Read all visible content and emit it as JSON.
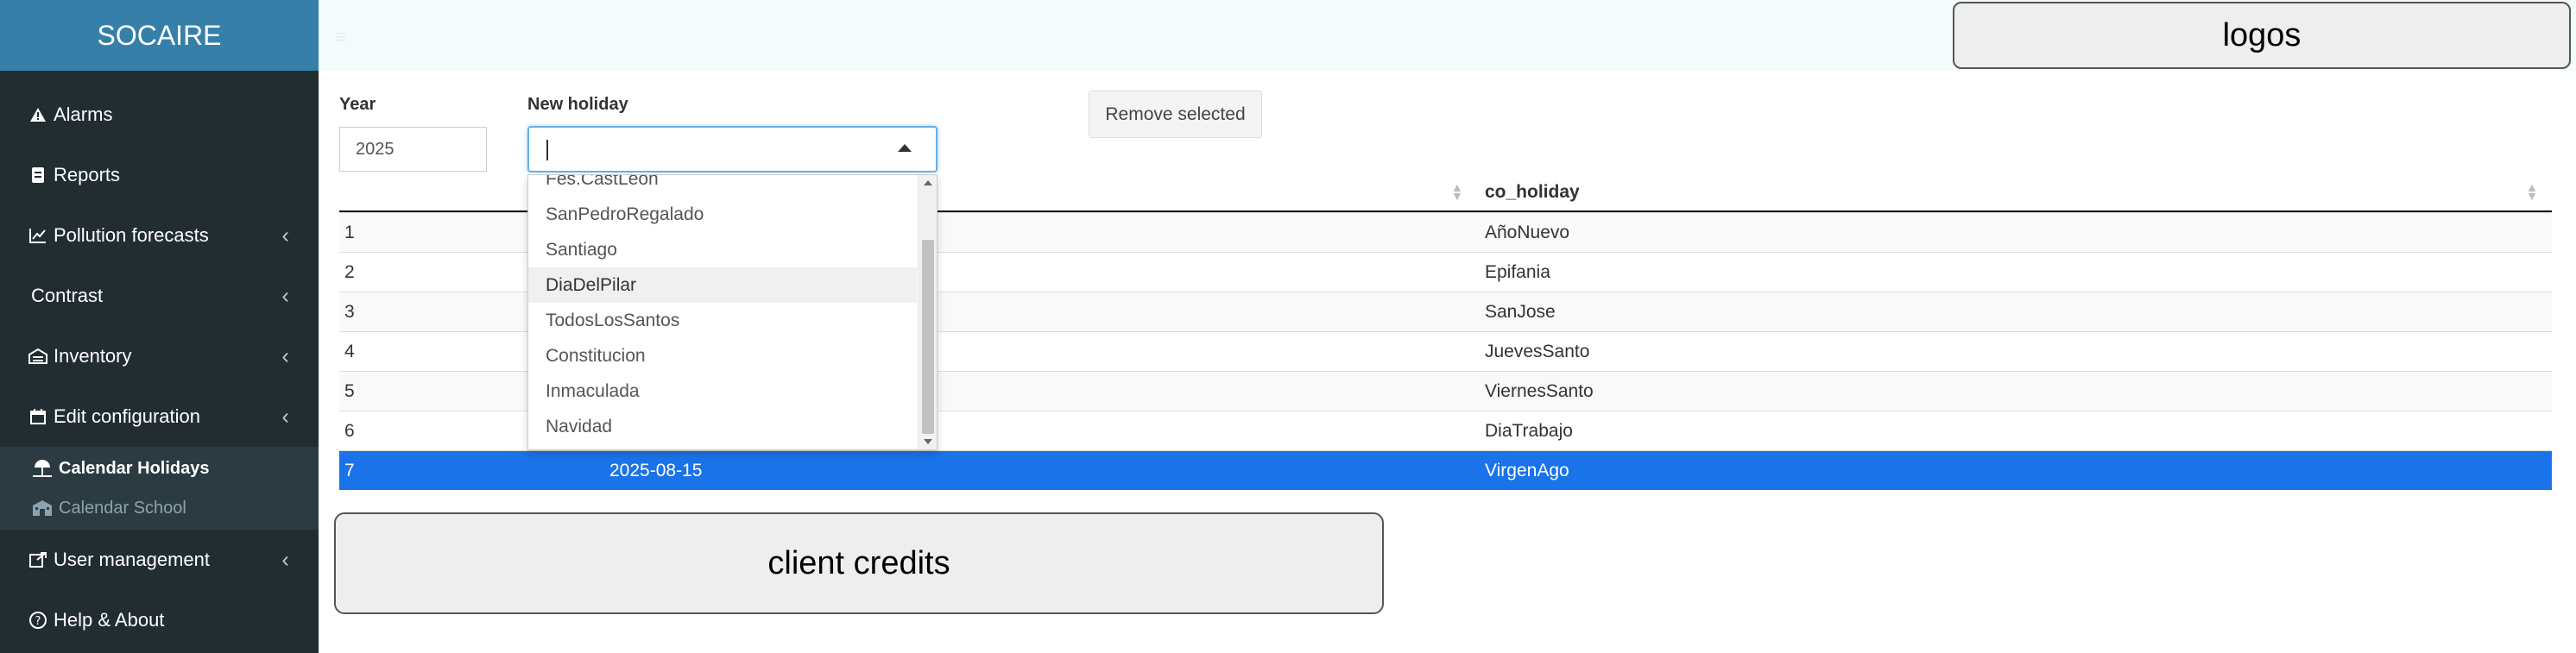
{
  "brand": {
    "title": "SOCAIRE",
    "color": "#367fa9"
  },
  "sidebar": {
    "bg": "#222d32",
    "items": [
      {
        "label": "Alarms",
        "icon": "warning-icon",
        "has_chevron": false
      },
      {
        "label": "Reports",
        "icon": "document-icon",
        "has_chevron": false
      },
      {
        "label": "Pollution forecasts",
        "icon": "line-chart-icon",
        "has_chevron": true
      },
      {
        "label": "Contrast",
        "icon": "",
        "has_chevron": true
      },
      {
        "label": "Inventory",
        "icon": "inventory-icon",
        "has_chevron": true
      },
      {
        "label": "Edit configuration",
        "icon": "calendar-icon",
        "has_chevron": true
      }
    ],
    "submenu": [
      {
        "label": "Calendar Holidays",
        "icon": "umbrella-beach-icon",
        "active": true
      },
      {
        "label": "Calendar School",
        "icon": "school-icon",
        "active": false
      }
    ],
    "bottom_items": [
      {
        "label": "User management",
        "icon": "share-icon",
        "has_chevron": true
      },
      {
        "label": "Help & About",
        "icon": "question-circle-icon",
        "has_chevron": false
      }
    ]
  },
  "header": {
    "logos_text": "logos"
  },
  "controls": {
    "year_label": "Year",
    "year_value": "2025",
    "holiday_label": "New holiday",
    "holiday_value": "",
    "remove_button": "Remove selected"
  },
  "table": {
    "columns": [
      "",
      "",
      "co_holiday"
    ],
    "rows": [
      {
        "id": "1",
        "date": "",
        "holiday": "AñoNuevo"
      },
      {
        "id": "2",
        "date": "",
        "holiday": "Epifania"
      },
      {
        "id": "3",
        "date": "",
        "holiday": "SanJose"
      },
      {
        "id": "4",
        "date": "",
        "holiday": "JuevesSanto"
      },
      {
        "id": "5",
        "date": "",
        "holiday": "ViernesSanto"
      },
      {
        "id": "6",
        "date": "",
        "holiday": "DiaTrabajo"
      },
      {
        "id": "7",
        "date": "2025-08-15",
        "holiday": "VirgenAgo"
      }
    ],
    "selected_row": 7,
    "selected_color": "#1a73e8"
  },
  "dropdown": {
    "options": [
      "Fes.CastLeon",
      "SanPedroRegalado",
      "Santiago",
      "DiaDelPilar",
      "TodosLosSantos",
      "Constitucion",
      "Inmaculada",
      "Navidad"
    ],
    "hover_option": "DiaDelPilar"
  },
  "credits": {
    "text": "client credits"
  }
}
